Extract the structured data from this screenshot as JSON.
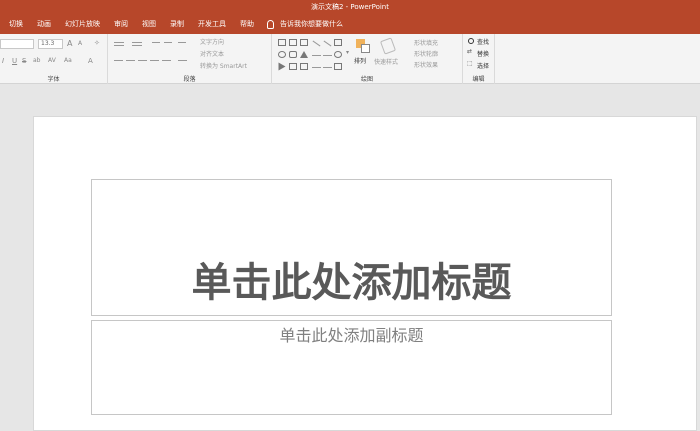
{
  "window": {
    "title": "演示文稿2 - PowerPoint"
  },
  "tabs": [
    "切换",
    "动画",
    "幻灯片放映",
    "审阅",
    "视图",
    "录制",
    "开发工具",
    "帮助"
  ],
  "tell_me": "告诉我你想要做什么",
  "font_group": {
    "label": "字体",
    "font_size": "13.3",
    "grow": "A",
    "shrink": "A",
    "styles": [
      "I",
      "U",
      "S",
      "ab",
      "AV",
      "Aa",
      "A"
    ]
  },
  "paragraph_group": {
    "label": "段落",
    "text_direction": "文字方向",
    "align_text": "对齐文本",
    "smartart": "转换为 SmartArt"
  },
  "drawing_group": {
    "label": "绘图",
    "arrange": "排列",
    "quick_styles": "快速样式",
    "shape_fill": "形状填充",
    "shape_outline": "形状轮廓",
    "shape_effects": "形状效果"
  },
  "editing_group": {
    "label": "编辑",
    "find": "查找",
    "replace": "替换",
    "select": "选择"
  },
  "slide": {
    "title_placeholder": "单击此处添加标题",
    "subtitle_placeholder": "单击此处添加副标题"
  }
}
